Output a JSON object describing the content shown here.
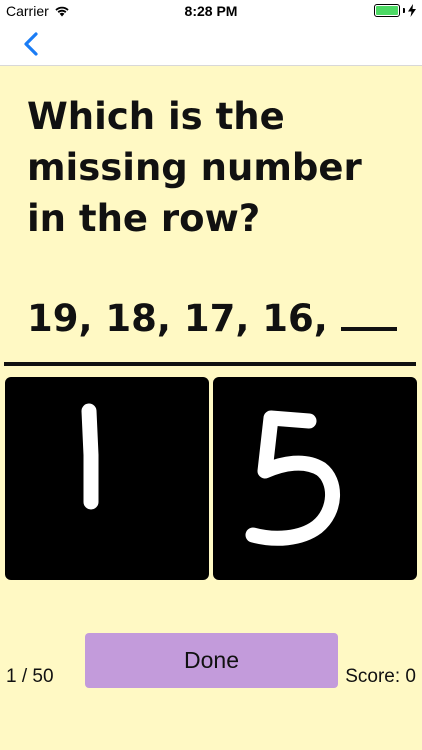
{
  "status_bar": {
    "carrier": "Carrier",
    "time": "8:28 PM",
    "battery_level": 1.0,
    "battery_color": "#4cd964"
  },
  "nav": {
    "back_icon": "chevron-left-icon",
    "accent_color": "#1a7cf5"
  },
  "question": {
    "text": "Which is the missing number in the row?",
    "sequence": "19, 18, 17, 16,"
  },
  "answer_pads": [
    {
      "drawn_digit": "1"
    },
    {
      "drawn_digit": "5"
    }
  ],
  "footer": {
    "progress": "1 / 50",
    "done_label": "Done",
    "score": "Score: 0"
  },
  "colors": {
    "background": "#fff9c4",
    "pad": "#000000",
    "done_button": "#c39bdb"
  }
}
